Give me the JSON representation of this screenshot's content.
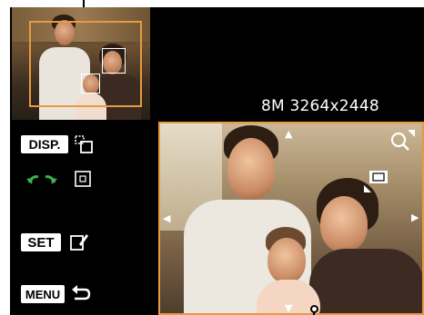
{
  "display": {
    "resolution_text": "8M 3264x2448"
  },
  "legend": {
    "disp_label": "DISP.",
    "set_label": "SET",
    "menu_label": "MENU"
  },
  "icons": {
    "disp_action": "display-toggle-icon",
    "arrows_action": "jump-arrows-icon",
    "face_action": "face-frame-icon",
    "set_action": "edit-frame-icon",
    "menu_action": "return-arrow-icon",
    "zoom_in": "magnify-icon",
    "zoom_frame": "zoom-frame-icon"
  },
  "colors": {
    "frame_orange": "#e89a3c",
    "arrows_green": "#3cb44b"
  }
}
